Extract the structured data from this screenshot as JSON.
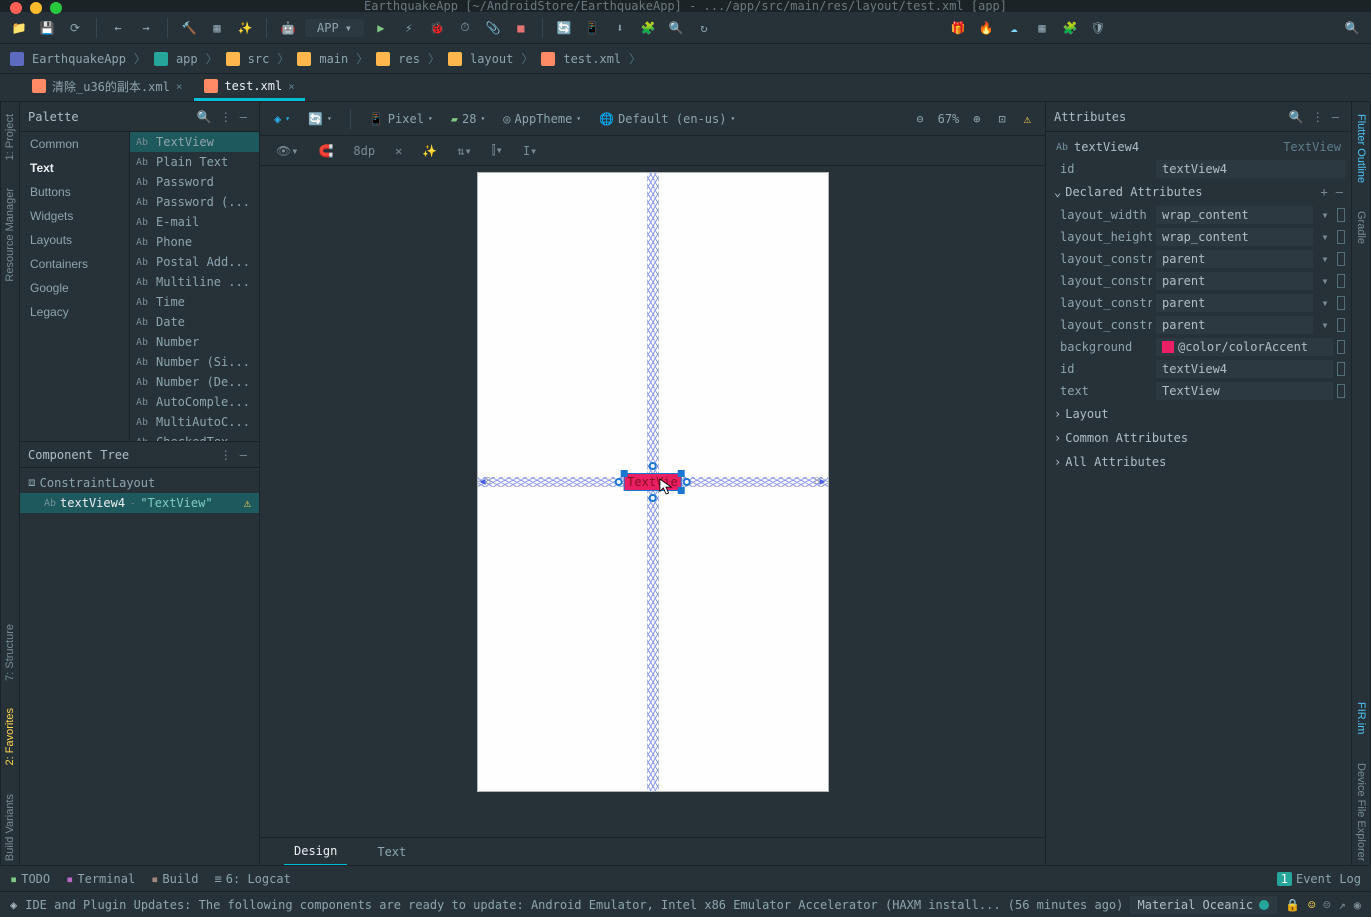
{
  "titlebar": "EarthquakeApp [~/AndroidStore/EarthquakeApp] - .../app/src/main/res/layout/test.xml [app]",
  "run_config": "APP",
  "breadcrumb": [
    "EarthquakeApp",
    "app",
    "src",
    "main",
    "res",
    "layout",
    "test.xml"
  ],
  "file_tabs": [
    {
      "name": "清除_u36的副本.xml",
      "active": false
    },
    {
      "name": "test.xml",
      "active": true
    }
  ],
  "left_strip": [
    "1: Project",
    "Resource Manager"
  ],
  "left_strip2": [
    "Build Variants",
    "2: Favorites",
    "7: Structure"
  ],
  "right_strip": [
    "Flutter Outline",
    "Gradle"
  ],
  "right_strip2": [
    "FIR.im",
    "Device File Explorer"
  ],
  "palette": {
    "title": "Palette",
    "categories": [
      "Common",
      "Text",
      "Buttons",
      "Widgets",
      "Layouts",
      "Containers",
      "Google",
      "Legacy"
    ],
    "selected_cat": "Text",
    "items": [
      "TextView",
      "Plain Text",
      "Password",
      "Password (...",
      "E-mail",
      "Phone",
      "Postal Add...",
      "Multiline ...",
      "Time",
      "Date",
      "Number",
      "Number (Si...",
      "Number (De...",
      "AutoComple...",
      "MultiAutoC...",
      "CheckedTex..."
    ],
    "selected_item": "TextView"
  },
  "component_tree": {
    "title": "Component Tree",
    "root": "ConstraintLayout",
    "child": {
      "name": "textView4",
      "desc": "\"TextView\""
    }
  },
  "design_toolbar": {
    "device": "Pixel",
    "api": "28",
    "theme": "AppTheme",
    "locale": "Default (en-us)",
    "zoom": "67%",
    "margin": "8dp"
  },
  "canvas": {
    "element_text": "TextVie",
    "margin": "8"
  },
  "attributes": {
    "title": "Attributes",
    "component": "textView4",
    "type": "TextView",
    "id": "textView4",
    "sections": {
      "declared": "Declared Attributes",
      "layout": "Layout",
      "common": "Common Attributes",
      "all": "All Attributes"
    },
    "declared": [
      {
        "k": "layout_width",
        "v": "wrap_content",
        "dd": true
      },
      {
        "k": "layout_height",
        "v": "wrap_content",
        "dd": true
      },
      {
        "k": "layout_constra",
        "v": "parent",
        "dd": true
      },
      {
        "k": "layout_constra",
        "v": "parent",
        "dd": true
      },
      {
        "k": "layout_constra",
        "v": "parent",
        "dd": true
      },
      {
        "k": "layout_constra",
        "v": "parent",
        "dd": true
      },
      {
        "k": "background",
        "v": "@color/colorAccent",
        "swatch": true
      },
      {
        "k": "id",
        "v": "textView4"
      },
      {
        "k": "text",
        "v": "TextView"
      }
    ]
  },
  "design_tabs": [
    "Design",
    "Text"
  ],
  "tool_windows": {
    "left": [
      "TODO",
      "Terminal",
      "Build",
      "6: Logcat"
    ],
    "right": "Event Log"
  },
  "status": {
    "msg": "IDE and Plugin Updates: The following components are ready to update: Android Emulator, Intel x86 Emulator Accelerator (HAXM install... (56 minutes ago)",
    "theme": "Material Oceanic",
    "event_count": "1"
  }
}
